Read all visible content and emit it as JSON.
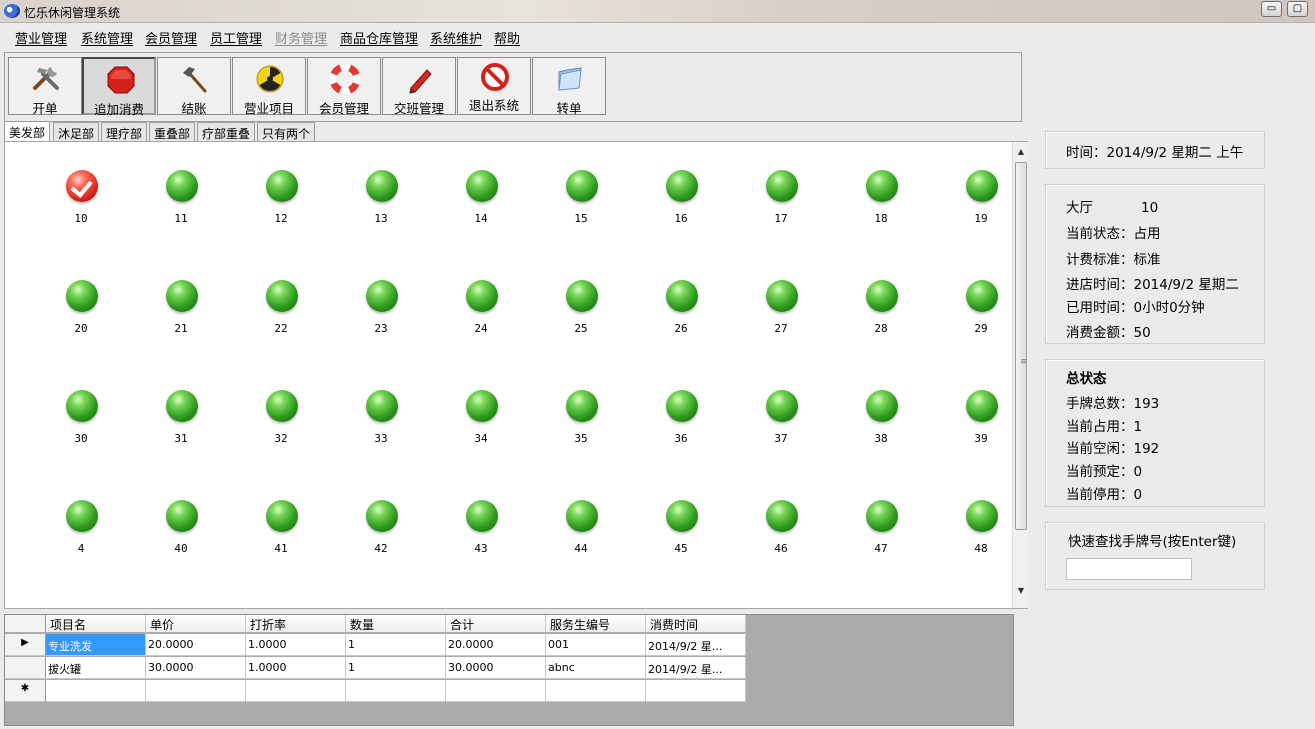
{
  "window": {
    "title": "忆乐休闲管理系统",
    "minimize_glyph": "▭"
  },
  "menu": [
    {
      "label": "营业管理",
      "disabled": false
    },
    {
      "label": "系统管理",
      "disabled": false
    },
    {
      "label": "会员管理",
      "disabled": false
    },
    {
      "label": "员工管理",
      "disabled": false
    },
    {
      "label": "财务管理",
      "disabled": true
    },
    {
      "label": "商品仓库管理",
      "disabled": false
    },
    {
      "label": "系统维护",
      "disabled": false
    },
    {
      "label": "帮助",
      "disabled": false
    }
  ],
  "toolbar": [
    {
      "label": "开单",
      "icon": "tools-icon"
    },
    {
      "label": "追加消费",
      "icon": "stop-sign-icon",
      "pressed": true
    },
    {
      "label": "结账",
      "icon": "hammer-icon"
    },
    {
      "label": "营业项目",
      "icon": "radiation-icon"
    },
    {
      "label": "会员管理",
      "icon": "lifebuoy-icon"
    },
    {
      "label": "交班管理",
      "icon": "pen-icon"
    },
    {
      "label": "退出系统",
      "icon": "no-entry-icon"
    },
    {
      "label": "转单",
      "icon": "folder-icon"
    }
  ],
  "tabs": [
    "美发部",
    "沐足部",
    "理疗部",
    "重叠部",
    "疗部重叠",
    "只有两个"
  ],
  "active_tab": "美发部",
  "rooms": [
    {
      "num": "10",
      "status": "occupied"
    },
    {
      "num": "11",
      "status": "free"
    },
    {
      "num": "12",
      "status": "free"
    },
    {
      "num": "13",
      "status": "free"
    },
    {
      "num": "14",
      "status": "free"
    },
    {
      "num": "15",
      "status": "free"
    },
    {
      "num": "16",
      "status": "free"
    },
    {
      "num": "17",
      "status": "free"
    },
    {
      "num": "18",
      "status": "free"
    },
    {
      "num": "19",
      "status": "free"
    },
    {
      "num": "20",
      "status": "free"
    },
    {
      "num": "21",
      "status": "free"
    },
    {
      "num": "22",
      "status": "free"
    },
    {
      "num": "23",
      "status": "free"
    },
    {
      "num": "24",
      "status": "free"
    },
    {
      "num": "25",
      "status": "free"
    },
    {
      "num": "26",
      "status": "free"
    },
    {
      "num": "27",
      "status": "free"
    },
    {
      "num": "28",
      "status": "free"
    },
    {
      "num": "29",
      "status": "free"
    },
    {
      "num": "30",
      "status": "free"
    },
    {
      "num": "31",
      "status": "free"
    },
    {
      "num": "32",
      "status": "free"
    },
    {
      "num": "33",
      "status": "free"
    },
    {
      "num": "34",
      "status": "free"
    },
    {
      "num": "35",
      "status": "free"
    },
    {
      "num": "36",
      "status": "free"
    },
    {
      "num": "37",
      "status": "free"
    },
    {
      "num": "38",
      "status": "free"
    },
    {
      "num": "39",
      "status": "free"
    },
    {
      "num": "4",
      "status": "free"
    },
    {
      "num": "40",
      "status": "free"
    },
    {
      "num": "41",
      "status": "free"
    },
    {
      "num": "42",
      "status": "free"
    },
    {
      "num": "43",
      "status": "free"
    },
    {
      "num": "44",
      "status": "free"
    },
    {
      "num": "45",
      "status": "free"
    },
    {
      "num": "46",
      "status": "free"
    },
    {
      "num": "47",
      "status": "free"
    },
    {
      "num": "48",
      "status": "free"
    }
  ],
  "grid": {
    "columns": [
      "项目名",
      "单价",
      "打折率",
      "数量",
      "合计",
      "服务生编号",
      "消费时间"
    ],
    "rows": [
      [
        "专业洗发",
        "20.0000",
        "1.0000",
        "1",
        "20.0000",
        "001",
        "2014/9/2 星..."
      ],
      [
        "拔火罐",
        "30.0000",
        "1.0000",
        "1",
        "30.0000",
        "abnc",
        "2014/9/2 星..."
      ]
    ],
    "current_row_marker": "▶",
    "new_row_marker": "✱"
  },
  "time_panel": {
    "text": "时间：2014/9/2 星期二 上午"
  },
  "room_info": {
    "hall_label": "大厅",
    "hall_value": "10",
    "lines": [
      "当前状态：占用",
      "计费标准：标准",
      "进店时间：2014/9/2 星期二",
      "已用时间：0小时0分钟",
      "消费金额：50"
    ]
  },
  "summary": {
    "title": "总状态",
    "lines": [
      "手牌总数：193",
      "当前占用：1",
      "当前空闲：192",
      "当前预定：0",
      "当前停用：0"
    ]
  },
  "quick_search": {
    "label": "快速查找手牌号(按Enter键)",
    "value": ""
  },
  "colors": {
    "free": "#2c9a1b",
    "occupied": "#d9261a",
    "selection": "#3399ff"
  }
}
